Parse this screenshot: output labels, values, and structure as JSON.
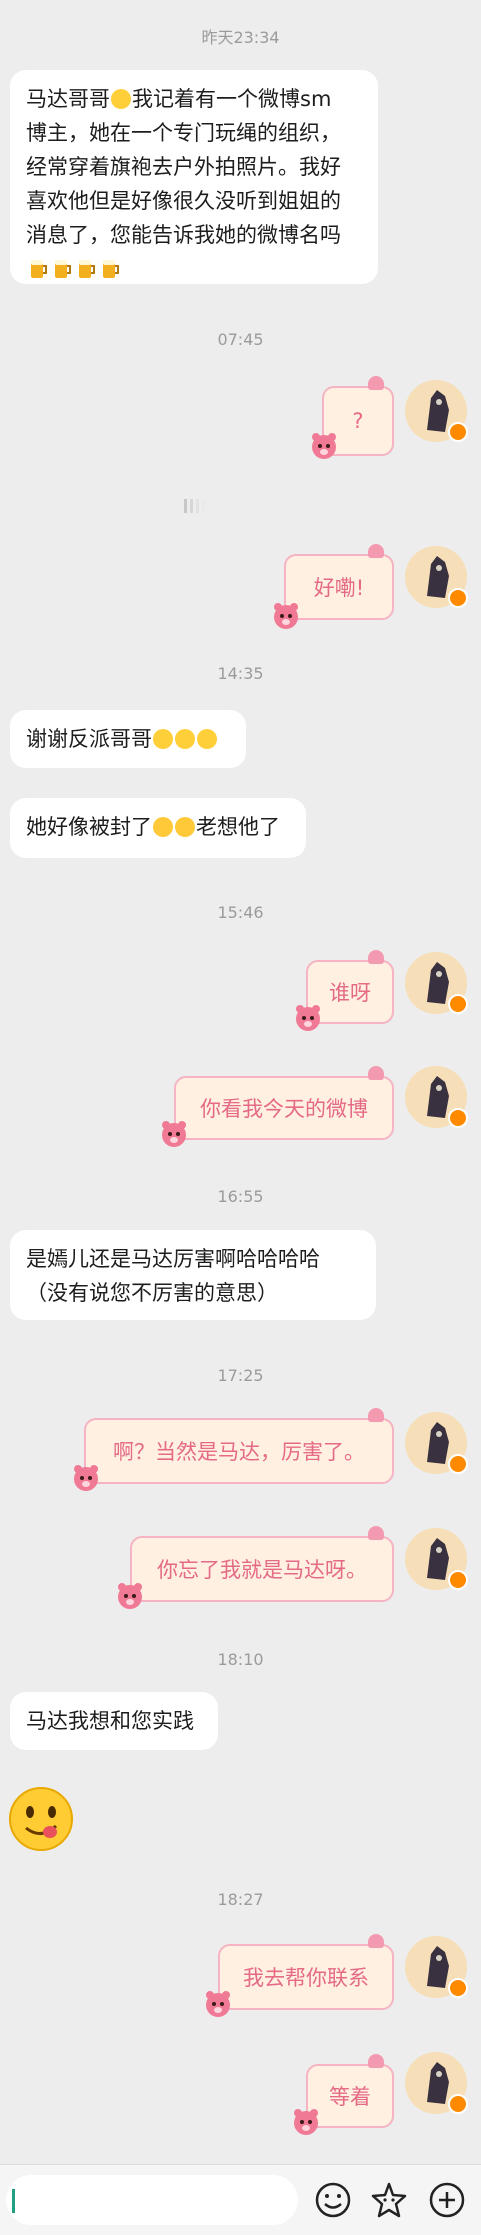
{
  "timestamps": [
    "昨天23:34",
    "07:45",
    "14:35",
    "15:46",
    "16:55",
    "17:25",
    "18:10",
    "18:27"
  ],
  "messages": {
    "m1": [
      "马达哥哥",
      "我记着有一个微博sm",
      "博主，她在一个专门玩绳的组织，",
      "经常穿着旗袍去户外拍照片。我好",
      "喜欢他但是好像很久没听到姐姐的",
      "消息了，您能告诉我她的微博名吗"
    ],
    "m2": "?",
    "m3": "好嘞!",
    "m4": "谢谢反派哥哥",
    "m5a": "她好像被封了",
    "m5b": "老想他了",
    "m6": "谁呀",
    "m7": "你看我今天的微博",
    "m8": [
      "是嫣儿还是马达厉害啊哈哈哈哈",
      "（没有说您不厉害的意思）"
    ],
    "m9": "啊？当然是马达，厉害了。",
    "m10": "你忘了我就是马达呀。",
    "m11": "马达我想和您实践",
    "m12": "我去帮你联系",
    "m13": "等着"
  },
  "icons": {
    "emoji": "emoji-icon",
    "sticker": "sticker-icon",
    "plus": "plus-icon"
  },
  "colors": {
    "background": "#ededed",
    "out_bubble_bg": "#fff0e1",
    "out_bubble_border": "#f6b3c3",
    "out_text": "#e56a86",
    "badge": "#ff8a00"
  }
}
